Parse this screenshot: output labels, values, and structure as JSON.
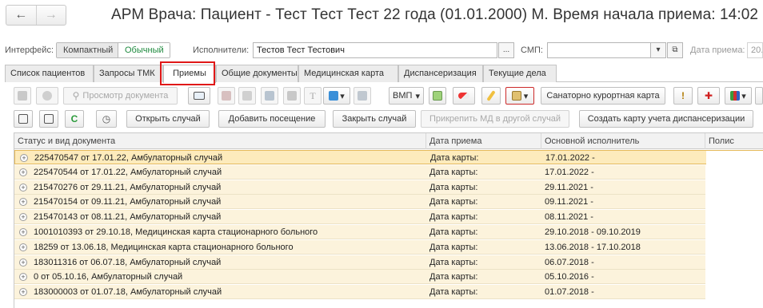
{
  "window": {
    "title": "АРМ Врача: Пациент - Тест Тест Тест 22 года  (01.01.2000) М. Время начала приема: 14:02",
    "back_icon": "←",
    "forward_icon": "→"
  },
  "filters": {
    "interface_label": "Интерфейс:",
    "mode_compact": "Компактный",
    "mode_normal": "Обычный",
    "executors_label": "Исполнители:",
    "executors_value": "Тестов Тест Тестович",
    "ellipsis": "...",
    "smp_label": "СМП:",
    "smp_value": "",
    "dropdown_arrow": "▾",
    "open_icon": "⧉",
    "reception_date_label": "Дата приема:",
    "reception_date_value": "20."
  },
  "tabs": [
    "Список пациентов",
    "Запросы ТМК",
    "Приемы",
    "Общие документы",
    "Медицинская карта",
    "Диспансеризация",
    "Текущие дела"
  ],
  "toolbar1": {
    "view_document": "Просмотр документа",
    "vmp": "ВМП",
    "spa_card": "Санаторно курортная карта",
    "dropdown": "▾"
  },
  "toolbar2": {
    "open_case": "Открыть случай",
    "add_visit": "Добавить посещение",
    "close_case": "Закрыть случай",
    "attach_md": "Прикрепить МД в другой случай",
    "create_card": "Создать карту учета диспансеризации"
  },
  "table": {
    "columns": [
      "Статус и вид документа",
      "Дата приема",
      "Основной исполнитель",
      "Полис"
    ],
    "rows": [
      {
        "doc": "225470547 от 17.01.22, Амбулаторный случай",
        "date": "Дата карты:",
        "period": "17.01.2022 -",
        "polis": ""
      },
      {
        "doc": "225470544 от 17.01.22, Амбулаторный случай",
        "date": "Дата карты:",
        "period": "17.01.2022 -",
        "polis": ""
      },
      {
        "doc": "215470276 от 29.11.21, Амбулаторный случай",
        "date": "Дата карты:",
        "period": "29.11.2021 -",
        "polis": ""
      },
      {
        "doc": "215470154 от 09.11.21, Амбулаторный случай",
        "date": "Дата карты:",
        "period": "09.11.2021 -",
        "polis": ""
      },
      {
        "doc": "215470143 от 08.11.21, Амбулаторный случай",
        "date": "Дата карты:",
        "period": "08.11.2021 -",
        "polis": ""
      },
      {
        "doc": "1001010393 от 29.10.18, Медицинская карта стационарного больного",
        "date": "Дата карты:",
        "period": "29.10.2018 - 09.10.2019",
        "polis": ""
      },
      {
        "doc": "18259 от 13.06.18, Медицинская карта стационарного больного",
        "date": "Дата карты:",
        "period": "13.06.2018 - 17.10.2018",
        "polis": ""
      },
      {
        "doc": "183011316 от 06.07.18, Амбулаторный случай",
        "date": "Дата карты:",
        "period": "06.07.2018 -",
        "polis": ""
      },
      {
        "doc": "0 от 05.10.16, Амбулаторный случай",
        "date": "Дата карты:",
        "period": "05.10.2016 -",
        "polis": ""
      },
      {
        "doc": "183000003 от 01.07.18, Амбулаторный случай",
        "date": "Дата карты:",
        "period": "01.07.2018 -",
        "polis": ""
      }
    ]
  },
  "icons": {
    "refresh": "C",
    "clock": "◷",
    "warning": "!",
    "plus_cross": "✚",
    "expand": "+"
  },
  "colors": {
    "row_bg": "#fcf3dc",
    "selected_row": "#fdebbc",
    "tab_highlight": "#e01818",
    "active_mode": "#1e8a3e"
  }
}
